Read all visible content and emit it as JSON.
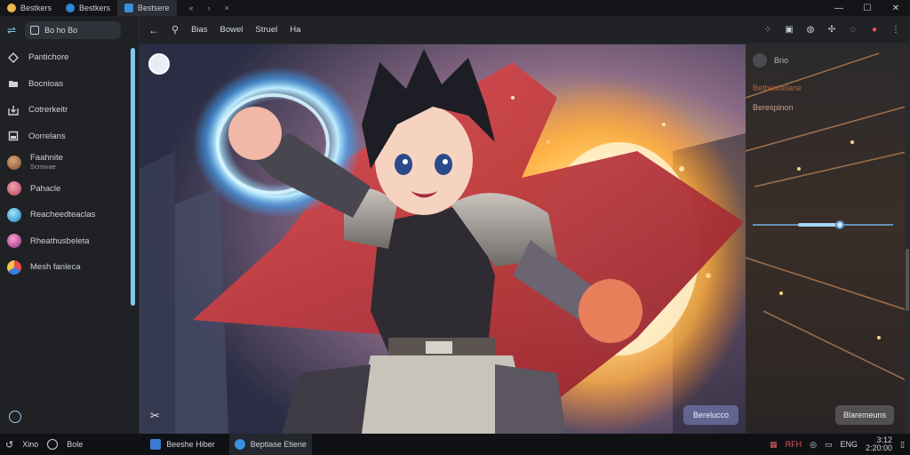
{
  "window": {
    "tabs": [
      {
        "label": "Bestkers",
        "icon": "app-icon"
      },
      {
        "label": "Bestkers",
        "icon": "app-icon"
      },
      {
        "label": "Bestsere",
        "icon": "app-icon"
      }
    ],
    "nav_glyphs": [
      "«",
      "›",
      "×"
    ],
    "controls": {
      "minimize": "—",
      "maximize": "☐",
      "close": "✕"
    }
  },
  "sidebar": {
    "search_label": "Bo ho Bo",
    "items": [
      {
        "label": "Pantichore",
        "icon": "diamond-icon"
      },
      {
        "label": "Bocnioas",
        "icon": "folder-icon"
      },
      {
        "label": "Cotrerkeitr",
        "icon": "download-icon"
      },
      {
        "label": "Oorrelans",
        "icon": "square-icon"
      },
      {
        "label": "Faahnite",
        "sublabel": "Scnsvae",
        "icon": "avatar-icon"
      },
      {
        "label": "Pahacle",
        "icon": "avatar-icon"
      },
      {
        "label": "Reacheedteaclas",
        "icon": "avatar-icon"
      },
      {
        "label": "Rheathusbeleta",
        "icon": "avatar-icon"
      },
      {
        "label": "Mesh fanleca",
        "icon": "avatar-icon"
      }
    ]
  },
  "toolbar": {
    "items": [
      "Bias",
      "Bowel",
      "Struel",
      "Ha"
    ],
    "right_icons": [
      "grid-icon",
      "image-icon",
      "globe-icon",
      "puzzle-icon",
      "shield-icon",
      "record-icon",
      "more-icon"
    ]
  },
  "viewport": {
    "button_label": "Berelucco"
  },
  "right_panel": {
    "title": "Brio",
    "line1": "Bethesbolane",
    "line2": "Berespinon",
    "slider_value": 0.62,
    "button_label": "Blaremeuns"
  },
  "taskbar": {
    "start_label": "Xino",
    "search_label": "Bole",
    "apps": [
      {
        "label": "Beeshe Hiber"
      },
      {
        "label": "Beptiase Etiene"
      }
    ],
    "tray": [
      "RFH",
      "ENG"
    ],
    "clock_time": "3:12",
    "clock_date": "2:20:00"
  },
  "colors": {
    "accent": "#7fc7f0",
    "cape_red": "#c93a3a",
    "flame": "#ffd27a",
    "energy_blue": "#7fd4ff"
  }
}
